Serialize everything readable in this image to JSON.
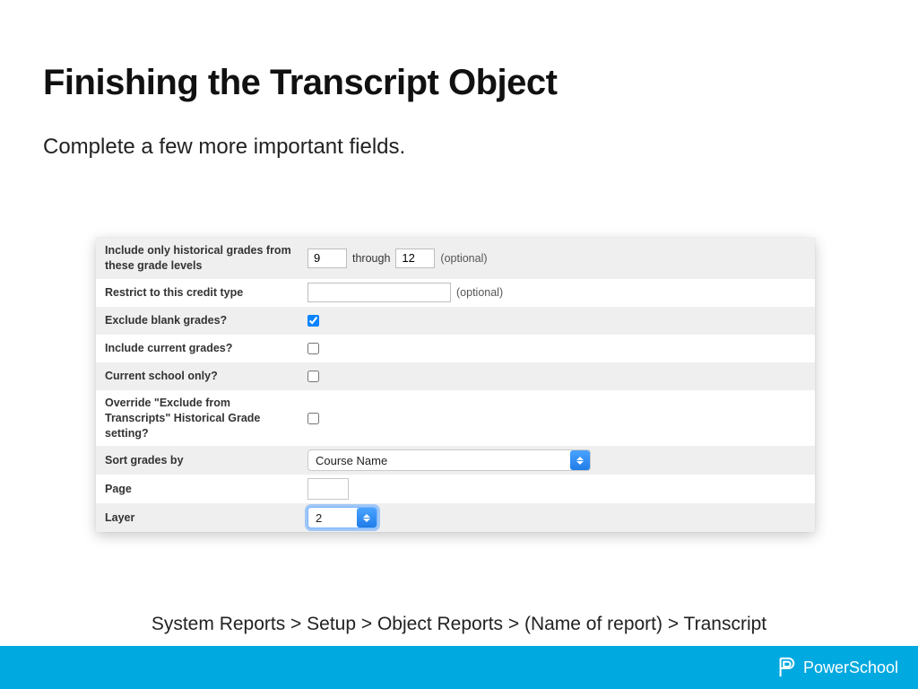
{
  "title": "Finishing the Transcript Object",
  "subtitle": "Complete a few more important fields.",
  "form": {
    "grade_levels": {
      "label": "Include only historical grades from these grade levels",
      "from": "9",
      "through_text": "through",
      "to": "12",
      "optional": "(optional)"
    },
    "credit_type": {
      "label": "Restrict to this credit type",
      "value": "",
      "optional": "(optional)"
    },
    "exclude_blank": {
      "label": "Exclude blank grades?",
      "checked": true
    },
    "include_current": {
      "label": "Include current grades?",
      "checked": false
    },
    "current_school": {
      "label": "Current school only?",
      "checked": false
    },
    "override_exclude": {
      "label": "Override \"Exclude from Transcripts\" Historical Grade setting?",
      "checked": false
    },
    "sort": {
      "label": "Sort grades by",
      "value": "Course Name"
    },
    "page": {
      "label": "Page",
      "value": ""
    },
    "layer": {
      "label": "Layer",
      "value": "2"
    }
  },
  "breadcrumb": "System Reports > Setup > Object Reports > (Name of report) > Transcript",
  "brand": "PowerSchool"
}
